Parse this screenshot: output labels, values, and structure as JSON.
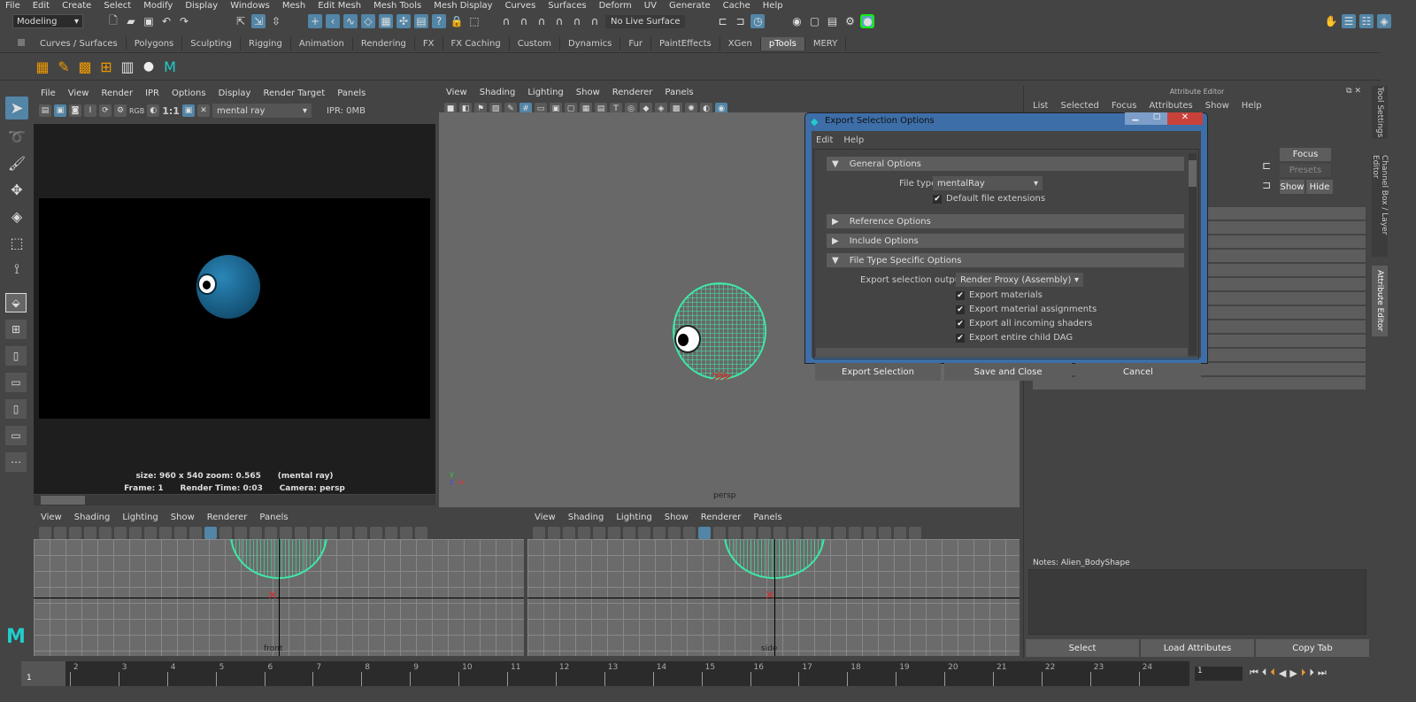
{
  "menubar": [
    "File",
    "Edit",
    "Create",
    "Select",
    "Modify",
    "Display",
    "Windows",
    "Mesh",
    "Edit Mesh",
    "Mesh Tools",
    "Mesh Display",
    "Curves",
    "Surfaces",
    "Deform",
    "UV",
    "Generate",
    "Cache",
    "Help"
  ],
  "status": {
    "mode": "Modeling",
    "live_surface": "No Live Surface"
  },
  "shelf_tabs": [
    "Curves / Surfaces",
    "Polygons",
    "Sculpting",
    "Rigging",
    "Animation",
    "Rendering",
    "FX",
    "FX Caching",
    "Custom",
    "Dynamics",
    "Fur",
    "PaintEffects",
    "XGen",
    "pTools",
    "MERY"
  ],
  "shelf_active": "pTools",
  "render_view": {
    "menu": [
      "File",
      "View",
      "Render",
      "IPR",
      "Options",
      "Display",
      "Render Target",
      "Panels"
    ],
    "rgb": "RGB",
    "ratio": "1:1",
    "renderer": "mental ray",
    "ipr": "IPR: 0MB",
    "info_line1": "size: 960 x 540 zoom: 0.565",
    "info_renderer": "(mental ray)",
    "frame": "Frame: 1",
    "render_time": "Render Time: 0:03",
    "camera": "Camera: persp"
  },
  "viewport_menu": [
    "View",
    "Shading",
    "Lighting",
    "Show",
    "Renderer",
    "Panels"
  ],
  "persp": {
    "label": "persp"
  },
  "front": {
    "label": "front"
  },
  "side": {
    "label": "side"
  },
  "dialog": {
    "title": "Export Selection Options",
    "menu": [
      "Edit",
      "Help"
    ],
    "general": "General Options",
    "file_type_label": "File type:",
    "file_type": "mentalRay",
    "default_ext": "Default file extensions",
    "reference": "Reference Options",
    "include": "Include Options",
    "specific": "File Type Specific Options",
    "output_label": "Export selection output:",
    "output": "Render Proxy (Assembly)",
    "checks": [
      "Export materials",
      "Export material assignments",
      "Export all incoming shaders",
      "Export entire child DAG"
    ],
    "buttons": [
      "Export Selection",
      "Save and Close",
      "Cancel"
    ]
  },
  "attr_editor": {
    "title": "Attribute Editor",
    "menu": [
      "List",
      "Selected",
      "Focus",
      "Attributes",
      "Show",
      "Help"
    ],
    "focus": "Focus",
    "presets": "Presets",
    "show": "Show",
    "hide": "Hide",
    "notes": "Notes:  Alien_BodyShape",
    "buttons": [
      "Select",
      "Load Attributes",
      "Copy Tab"
    ]
  },
  "side_tabs": [
    "Tool Settings",
    "Channel Box / Layer Editor",
    "Attribute Editor"
  ],
  "timeline": {
    "ticks": [
      "1",
      "2",
      "3",
      "4",
      "5",
      "6",
      "7",
      "8",
      "9",
      "10",
      "11",
      "12",
      "13",
      "14",
      "15",
      "16",
      "17",
      "18",
      "19",
      "20",
      "21",
      "22",
      "23",
      "24"
    ],
    "current": "1",
    "frame_field": "1"
  },
  "colors": {
    "accent": "#5285a6",
    "wire": "#3fe7a6",
    "render_bg": "#000000"
  }
}
